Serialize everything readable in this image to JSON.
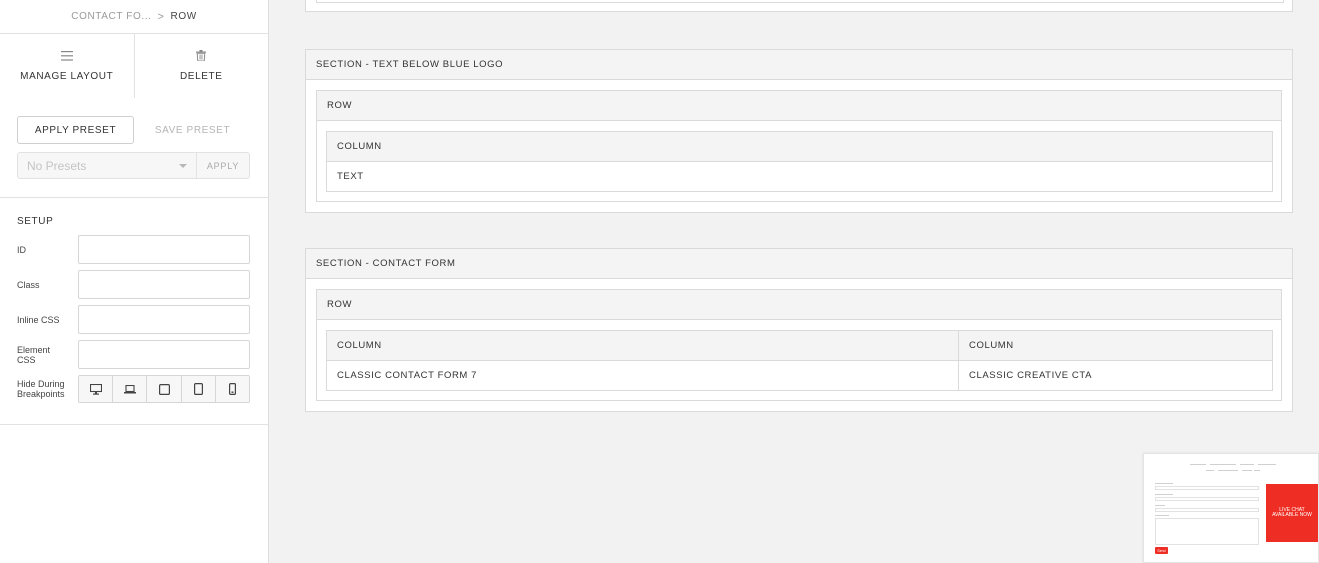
{
  "breadcrumb": {
    "parent": "CONTACT FO...",
    "separator": ">",
    "current": "ROW"
  },
  "actions": {
    "manage_layout": "MANAGE LAYOUT",
    "delete": "DELETE"
  },
  "presets": {
    "apply_preset": "APPLY PRESET",
    "save_preset": "SAVE PRESET",
    "select_value": "No Presets",
    "apply": "APPLY"
  },
  "setup": {
    "title": "SETUP",
    "fields": {
      "id": "ID",
      "class": "Class",
      "inline_css": "Inline CSS",
      "element_css_1": "Element",
      "element_css_2": "CSS",
      "hide_1": "Hide During",
      "hide_2": "Breakpoints"
    },
    "breakpoint_icons": [
      "desktop-icon",
      "laptop-icon",
      "tablet-landscape-icon",
      "tablet-portrait-icon",
      "mobile-icon"
    ]
  },
  "sections": [
    {
      "title": "SECTION - TEXT BELOW BLUE LOGO",
      "row": "ROW",
      "columns": [
        {
          "title": "COLUMN",
          "element": "TEXT"
        }
      ]
    },
    {
      "title": "SECTION - CONTACT FORM",
      "row": "ROW",
      "columns": [
        {
          "title": "COLUMN",
          "element": "CLASSIC CONTACT FORM 7"
        },
        {
          "title": "COLUMN",
          "element": "CLASSIC CREATIVE CTA"
        }
      ]
    }
  ],
  "preview": {
    "cta_text": "LIVE CHAT AVAILABLE NOW",
    "send_label": "Send",
    "accent": "#ee2e24"
  },
  "colors": {
    "background": "#f2f2f2",
    "panel": "#ffffff",
    "border": "#dadada",
    "header_bg": "#f4f4f4"
  }
}
